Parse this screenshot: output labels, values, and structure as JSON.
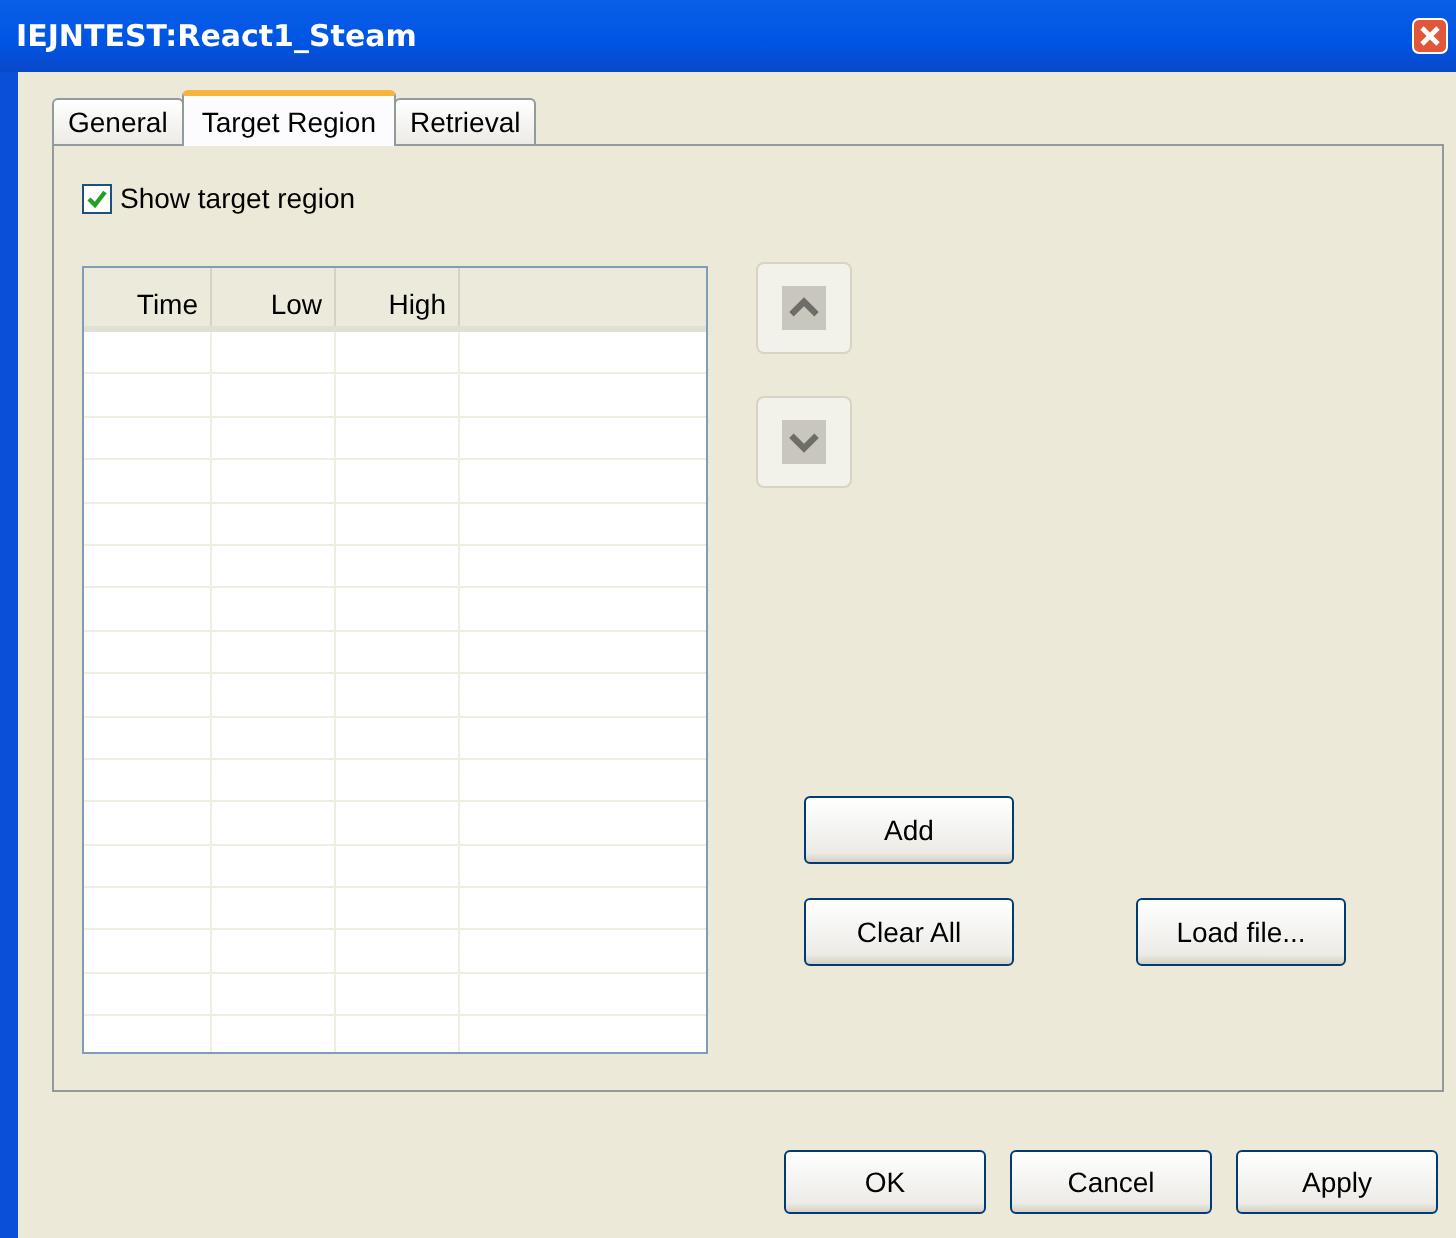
{
  "window": {
    "title": "IEJNTEST:React1_Steam"
  },
  "tabs": [
    {
      "label": "General",
      "selected": false
    },
    {
      "label": "Target Region",
      "selected": true
    },
    {
      "label": "Retrieval",
      "selected": false
    }
  ],
  "show_target_region": {
    "label": "Show target region",
    "checked": true
  },
  "table": {
    "columns": [
      "Time",
      "Low",
      "High"
    ]
  },
  "move_buttons": [
    {
      "kind": "up",
      "disabled": true
    },
    {
      "kind": "down",
      "disabled": true
    }
  ],
  "add_button": "Add",
  "clear_all_button": "Clear All",
  "load_file_button": "Load file...",
  "dialog_buttons": [
    "OK",
    "Cancel",
    "Apply"
  ]
}
